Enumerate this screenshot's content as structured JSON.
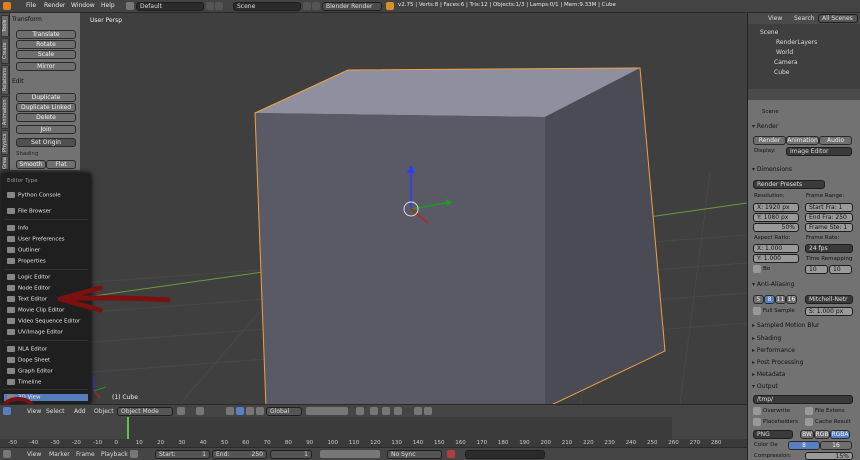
{
  "topbar": {
    "menu": [
      "File",
      "Render",
      "Window",
      "Help"
    ],
    "layout": "Default",
    "scene": "Scene",
    "engine": "Blender Render",
    "stats": "v2.75 | Verts:8 | Faces:6 | Tris:12 | Objects:1/3 | Lamps:0/1 | Mem:9.33M | Cube"
  },
  "tabs": [
    "Tools",
    "Create",
    "Relations",
    "Animation",
    "Physics",
    "Grease Pencil"
  ],
  "tools": {
    "transform_header": "Transform",
    "translate": "Translate",
    "rotate": "Rotate",
    "scale": "Scale",
    "mirror": "Mirror",
    "edit_header": "Edit",
    "duplicate": "Duplicate",
    "duplicate_linked": "Duplicate Linked",
    "delete": "Delete",
    "join": "Join",
    "set_origin": "Set Origin",
    "shading": "Shading",
    "smooth": "Smooth",
    "flat": "Flat"
  },
  "viewport": {
    "title": "User Persp",
    "object_label": "(1) Cube"
  },
  "editor_menu": {
    "title": "Editor Type",
    "items": {
      "python": "Python Console",
      "file": "File Browser",
      "info": "Info",
      "prefs": "User Preferences",
      "outliner": "Outliner",
      "properties": "Properties",
      "logic": "Logic Editor",
      "node": "Node Editor",
      "text": "Text Editor",
      "movie": "Movie Clip Editor",
      "vse": "Video Sequence Editor",
      "uv": "UV/Image Editor",
      "nla": "NLA Editor",
      "dope": "Dope Sheet",
      "graph": "Graph Editor",
      "time": "Timeline",
      "view3d": "3D View"
    }
  },
  "view_header": {
    "view": "View",
    "select": "Select",
    "add": "Add",
    "object": "Object",
    "mode": "Object Mode",
    "orientation": "Global"
  },
  "timeline": {
    "ticks": [
      "-50",
      "-40",
      "-30",
      "-20",
      "-10",
      "0",
      "10",
      "20",
      "30",
      "40",
      "50",
      "60",
      "70",
      "80",
      "90",
      "100",
      "110",
      "120",
      "130",
      "140",
      "150",
      "160",
      "170",
      "180",
      "190",
      "200",
      "210",
      "220",
      "230",
      "240",
      "250",
      "260",
      "270",
      "280"
    ],
    "menu": [
      "View",
      "Marker",
      "Frame",
      "Playback"
    ],
    "start": "Start:",
    "start_val": "1",
    "end": "End:",
    "end_val": "250",
    "current": "1",
    "sync": "No Sync"
  },
  "outliner": {
    "view": "View",
    "search": "Search",
    "all": "All Scenes",
    "items": [
      "Scene",
      "RenderLayers",
      "World",
      "Camera",
      "Cube"
    ]
  },
  "props": {
    "scene": "Scene",
    "render_header": "Render",
    "render_btn": "Render",
    "anim_btn": "Animation",
    "audio_btn": "Audio",
    "display_label": "Display:",
    "display_val": "Image Editor",
    "dimensions": "Dimensions",
    "presets": "Render Presets",
    "resolution": "Resolution:",
    "frame_range": "Frame Range:",
    "res_x": "X: 1920 px",
    "res_y": "Y: 1080 px",
    "percent": "50%",
    "start_frame": "Start Fra: 1",
    "end_frame": "End Fra: 250",
    "frame_step": "Frame Ste: 1",
    "aspect": "Aspect Ratio:",
    "frame_rate": "Frame Rate:",
    "asp_x": "X: 1.000",
    "asp_y": "Y: 1.000",
    "fps": "24 fps",
    "remap": "Time Remapping",
    "border": "Bo",
    "remap_a": "10",
    "remap_b": "10",
    "aa": "Anti-Aliasing",
    "aa_vals": [
      "5",
      "8",
      "11",
      "16"
    ],
    "filter": "Mitchell-Netr",
    "full_sample": "Full Sample",
    "size": "S: 1.000 px",
    "motion_blur": "Sampled Motion Blur",
    "shading": "Shading",
    "performance": "Performance",
    "post": "Post Processing",
    "metadata": "Metadata",
    "output": "Output",
    "path": "/tmp/",
    "overwrite": "Overwrite",
    "file_ext": "File Extens",
    "placeholders": "Placeholders",
    "cache": "Cache Result",
    "format": "PNG",
    "bw": "BW",
    "rgb": "RGB",
    "rgba": "RGBA",
    "color_depth": "Color De",
    "depth_a": "8",
    "depth_b": "16",
    "compression": "Compression:",
    "compression_val": "15%"
  },
  "colors": {
    "accent": "#5680c2",
    "selection": "#f0a040",
    "annotation": "#7a1010"
  }
}
